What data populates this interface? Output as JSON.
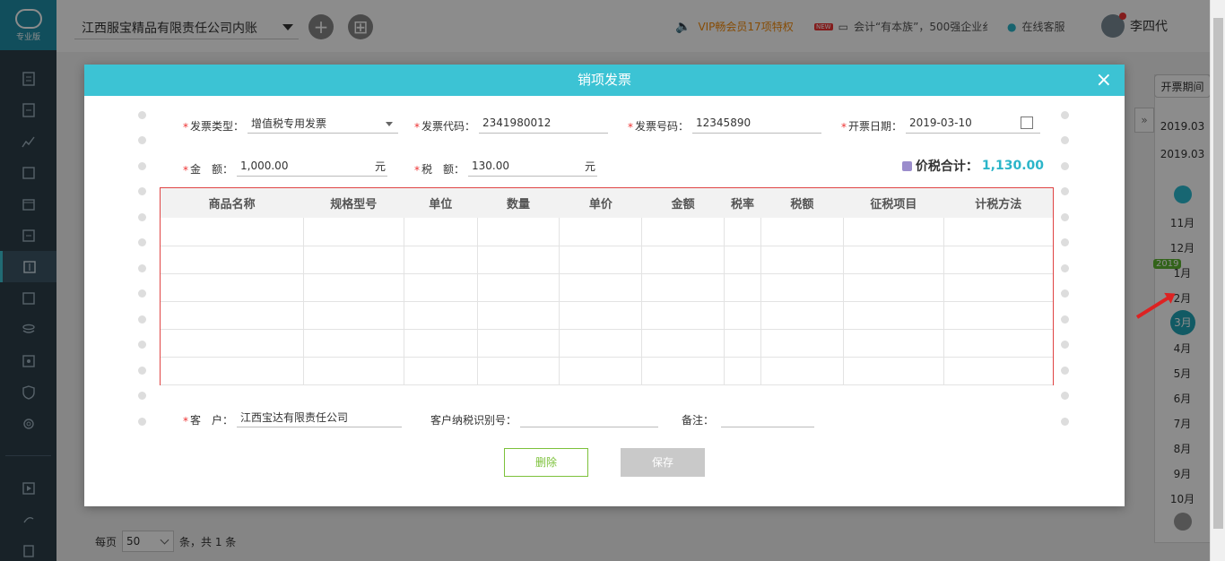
{
  "topbar": {
    "company": "江西服宝精品有限责任公司内账",
    "vip": "VIP畅会员17项特权",
    "new_badge": "NEW",
    "notice": "会计“有本族”，500强企业纟",
    "service": "在线客服",
    "user": "李四代"
  },
  "sidebar": {
    "logo_text": "专业版"
  },
  "period": {
    "title": "开票期间",
    "start": "2019.03",
    "end": "2019.03",
    "year_tag": "2019",
    "months": [
      "11月",
      "12月",
      "1月",
      "2月",
      "3月",
      "4月",
      "5月",
      "6月",
      "7月",
      "8月",
      "9月",
      "10月"
    ],
    "selected": "3月"
  },
  "pager": {
    "per_page_label": "每页",
    "per_page_value": "50",
    "summary": "条，共 1 条"
  },
  "modal": {
    "title": "销项发票",
    "close": "×",
    "fields": {
      "type_label": "发票类型：",
      "type_value": "增值税专用发票",
      "code_label": "发票代码：",
      "code_value": "2341980012",
      "number_label": "发票号码：",
      "number_value": "12345890",
      "date_label": "开票日期：",
      "date_value": "2019-03-10",
      "amount_label": "金　额：",
      "amount_value": "1,000.00",
      "amount_unit": "元",
      "tax_label": "税　额：",
      "tax_value": "130.00",
      "tax_unit": "元",
      "total_label": "价税合计：",
      "total_value": "1,130.00",
      "customer_label": "客　户：",
      "customer_value": "江西宝达有限责任公司",
      "taxid_label": "客户纳税识别号：",
      "taxid_value": "",
      "remark_label": "备注：",
      "remark_value": ""
    },
    "table": {
      "headers": [
        "商品名称",
        "规格型号",
        "单位",
        "数量",
        "单价",
        "金额",
        "税率",
        "税额",
        "征税项目",
        "计税方法"
      ]
    },
    "buttons": {
      "delete": "删除",
      "save": "保存"
    }
  },
  "colors": {
    "accent": "#3cc3d4",
    "total": "#2bb5c9",
    "border_red": "#e04444",
    "delete_green": "#7cc13a"
  }
}
